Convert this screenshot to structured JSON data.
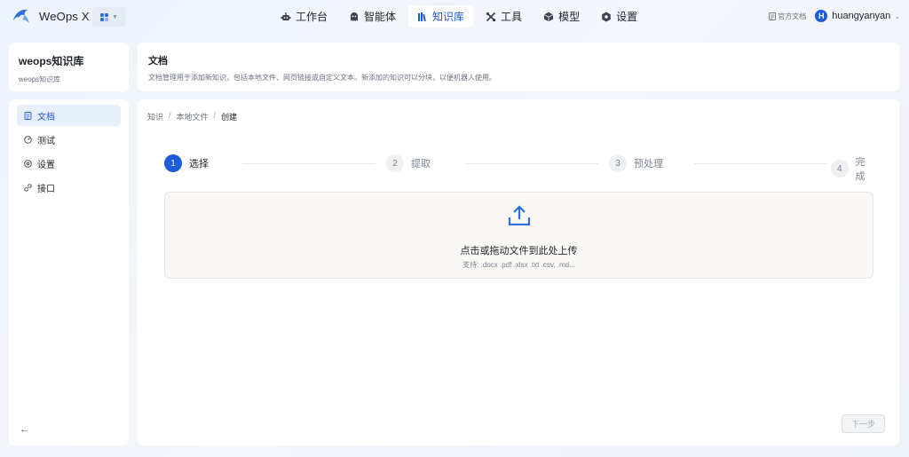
{
  "brand": {
    "name": "WeOps X",
    "logo_icon": "dolphin-logo-icon"
  },
  "nav": {
    "items": [
      {
        "label": "工作台",
        "icon": "robot-icon",
        "active": false
      },
      {
        "label": "智能体",
        "icon": "ghost-icon",
        "active": false
      },
      {
        "label": "知识库",
        "icon": "books-icon",
        "active": true
      },
      {
        "label": "工具",
        "icon": "tools-icon",
        "active": false
      },
      {
        "label": "模型",
        "icon": "cube-icon",
        "active": false
      },
      {
        "label": "设置",
        "icon": "gear-icon",
        "active": false
      }
    ]
  },
  "topright": {
    "docs_label": "官方文档",
    "username": "huangyanyan",
    "avatar_letter": "H"
  },
  "kb": {
    "title": "weops知识库",
    "subtitle": "weops知识库"
  },
  "header": {
    "title": "文档",
    "description": "文档管理用于添加新知识，包括本地文件、网页链接或自定义文本。新添加的知识可以分块，以便机器人使用。"
  },
  "sidebar": {
    "items": [
      {
        "label": "文档",
        "icon": "document-icon",
        "active": true
      },
      {
        "label": "测试",
        "icon": "test-icon",
        "active": false
      },
      {
        "label": "设置",
        "icon": "settings-icon",
        "active": false
      },
      {
        "label": "接口",
        "icon": "link-icon",
        "active": false
      }
    ],
    "collapse_icon": "arrow-left-icon"
  },
  "breadcrumb": {
    "items": [
      "知识",
      "本地文件",
      "创建"
    ],
    "separator": "/"
  },
  "steps": [
    {
      "num": "1",
      "label": "选择",
      "active": true
    },
    {
      "num": "2",
      "label": "提取",
      "active": false
    },
    {
      "num": "3",
      "label": "预处理",
      "active": false
    },
    {
      "num": "4",
      "label": "完成",
      "active": false
    }
  ],
  "upload": {
    "title": "点击或拖动文件到此处上传",
    "hint": "支持: .docx .pdf .xlsx .txt .csv, .md...",
    "icon": "upload-icon"
  },
  "footer": {
    "next_label": "下一步"
  },
  "colors": {
    "accent": "#1e5bd8",
    "active_bg": "#e7effc",
    "upload_bg": "#faf8f4"
  }
}
